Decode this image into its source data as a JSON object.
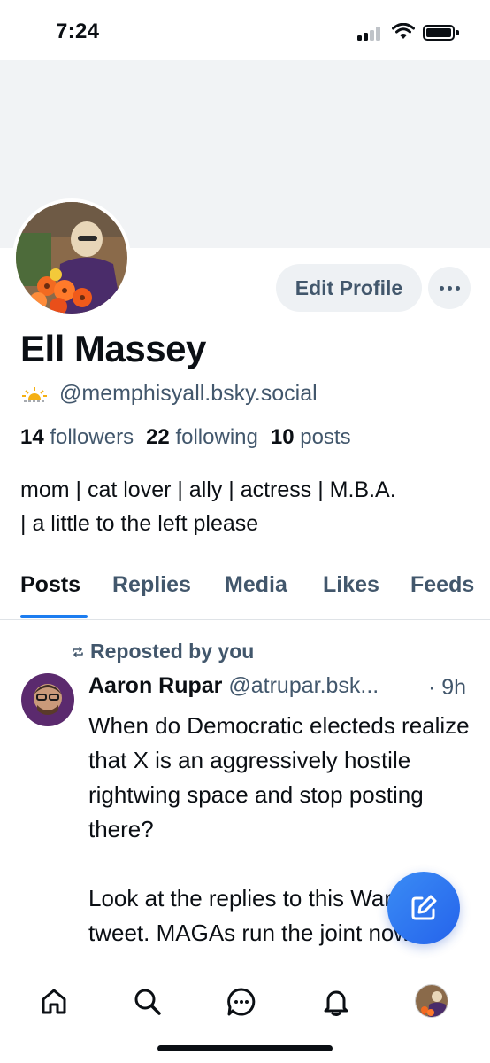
{
  "status_bar": {
    "time": "7:24",
    "signal_icon": "cellular-signal-icon",
    "wifi_icon": "wifi-icon",
    "battery_icon": "battery-icon"
  },
  "profile": {
    "display_name": "Ell Massey",
    "handle_emoji_icon": "sunrise-icon",
    "handle": "@memphisyall.bsky.social",
    "followers_count": "14",
    "followers_label": "followers",
    "following_count": "22",
    "following_label": "following",
    "posts_count": "10",
    "posts_label": "posts",
    "bio_line1": "mom | cat lover | ally | actress | M.B.A.",
    "bio_line2": "| a little to the left please",
    "edit_profile_label": "Edit Profile",
    "more_icon": "ellipsis-icon"
  },
  "tabs": [
    {
      "label": "Posts",
      "active": true
    },
    {
      "label": "Replies",
      "active": false
    },
    {
      "label": "Media",
      "active": false
    },
    {
      "label": "Likes",
      "active": false
    },
    {
      "label": "Feeds",
      "active": false
    }
  ],
  "post": {
    "repost_icon": "repost-icon",
    "repost_label": "Reposted by you",
    "author": "Aaron Rupar",
    "handle": "@atrupar.bsk...",
    "time": "· 9h",
    "body": "When do Democratic electeds realize that X is an aggressively hostile rightwing space and stop posting there?\n\nLook at the replies to this Warren tweet. MAGAs run the joint now."
  },
  "fab": {
    "icon": "compose-icon"
  },
  "bottom_nav": [
    {
      "icon": "home-icon"
    },
    {
      "icon": "search-icon"
    },
    {
      "icon": "chat-icon"
    },
    {
      "icon": "bell-icon"
    },
    {
      "icon": "profile-avatar"
    }
  ],
  "colors": {
    "accent": "#1c7df0",
    "muted_text": "#42576c",
    "banner": "#f1f3f5",
    "button_bg": "#eef1f4"
  }
}
